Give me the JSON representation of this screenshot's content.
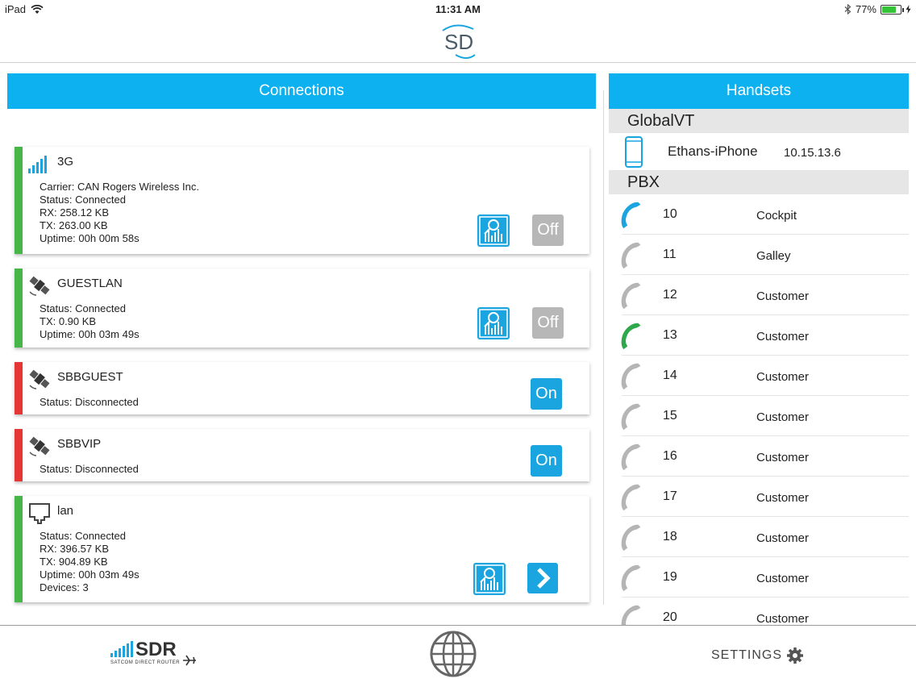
{
  "status_bar": {
    "device": "iPad",
    "time": "11:31 AM",
    "battery": "77%",
    "battery_level": 0.77
  },
  "connections": {
    "title": "Connections",
    "cards": [
      {
        "name": "3G",
        "status_color": "#47b648",
        "lines": [
          "Carrier: CAN Rogers Wireless Inc.",
          "Status: Connected",
          "RX: 258.12 KB",
          "TX: 263.00 KB",
          "Uptime: 00h 00m 58s"
        ],
        "toggle": "Off"
      },
      {
        "name": "GUESTLAN",
        "status_color": "#47b648",
        "lines": [
          "Status: Connected",
          "TX: 0.90 KB",
          "Uptime: 00h 03m 49s"
        ],
        "toggle": "Off"
      },
      {
        "name": "SBBGUEST",
        "status_color": "#e53535",
        "lines": [
          "Status: Disconnected"
        ],
        "toggle": "On"
      },
      {
        "name": "SBBVIP",
        "status_color": "#e53535",
        "lines": [
          "Status: Disconnected"
        ],
        "toggle": "On"
      },
      {
        "name": "lan",
        "status_color": "#47b648",
        "lines": [
          "Status: Connected",
          "RX: 396.57 KB",
          "TX: 904.89 KB",
          "Uptime: 00h 03m 49s",
          "Devices: 3"
        ]
      }
    ]
  },
  "handsets": {
    "title": "Handsets",
    "global_section": "GlobalVT",
    "global_device": {
      "name": "Ethans-iPhone",
      "ip": "10.15.13.6"
    },
    "pbx_section": "PBX",
    "extensions": [
      {
        "number": "10",
        "name": "Cockpit",
        "phone_color": "#1aa5e1"
      },
      {
        "number": "11",
        "name": "Galley",
        "phone_color": "#b5b5b5"
      },
      {
        "number": "12",
        "name": "Customer",
        "phone_color": "#b5b5b5"
      },
      {
        "number": "13",
        "name": "Customer",
        "phone_color": "#2ea84a"
      },
      {
        "number": "14",
        "name": "Customer",
        "phone_color": "#b5b5b5"
      },
      {
        "number": "15",
        "name": "Customer",
        "phone_color": "#b5b5b5"
      },
      {
        "number": "16",
        "name": "Customer",
        "phone_color": "#b5b5b5"
      },
      {
        "number": "17",
        "name": "Customer",
        "phone_color": "#b5b5b5"
      },
      {
        "number": "18",
        "name": "Customer",
        "phone_color": "#b5b5b5"
      },
      {
        "number": "19",
        "name": "Customer",
        "phone_color": "#b5b5b5"
      },
      {
        "number": "20",
        "name": "Customer",
        "phone_color": "#b5b5b5"
      }
    ]
  },
  "footer": {
    "sdr_text": "SDR",
    "sdr_subtext": "SATCOM DIRECT ROUTER",
    "settings_label": "SETTINGS"
  },
  "colors": {
    "accent": "#0db1ef",
    "connected": "#47b648",
    "disconnected": "#e53535"
  }
}
